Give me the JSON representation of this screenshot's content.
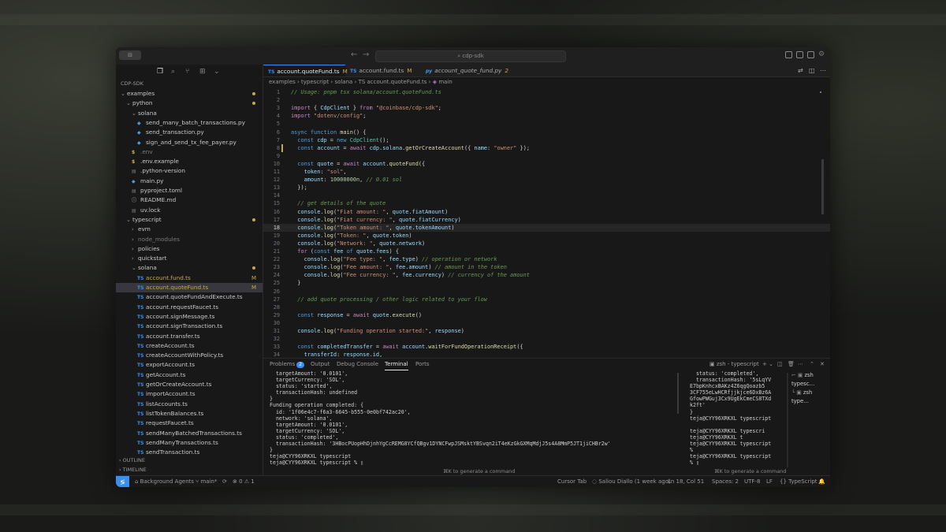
{
  "window": {
    "title": "cdp-sdk",
    "sidebar_toggle": "⊟"
  },
  "explorer": {
    "root": "CDP-SDK",
    "rows": [
      {
        "label": "examples",
        "kind": "folder",
        "open": true,
        "depth": 0,
        "mod": "dot"
      },
      {
        "label": "python",
        "kind": "folder",
        "open": true,
        "depth": 1,
        "mod": "dot"
      },
      {
        "label": "solana",
        "kind": "folder",
        "open": true,
        "depth": 2,
        "mod": ""
      },
      {
        "label": "send_many_batch_transactions.py",
        "kind": "py",
        "depth": 3,
        "mod": ""
      },
      {
        "label": "send_transaction.py",
        "kind": "py",
        "depth": 3,
        "mod": ""
      },
      {
        "label": "sign_and_send_tx_fee_payer.py",
        "kind": "py",
        "depth": 3,
        "mod": ""
      },
      {
        "label": ".env",
        "kind": "env",
        "depth": 2,
        "mod": "",
        "dim": true
      },
      {
        "label": ".env.example",
        "kind": "env",
        "depth": 2,
        "mod": ""
      },
      {
        "label": ".python-version",
        "kind": "file",
        "depth": 2,
        "mod": ""
      },
      {
        "label": "main.py",
        "kind": "py",
        "depth": 2,
        "mod": ""
      },
      {
        "label": "pyproject.toml",
        "kind": "file",
        "depth": 2,
        "mod": ""
      },
      {
        "label": "README.md",
        "kind": "info",
        "depth": 2,
        "mod": ""
      },
      {
        "label": "uv.lock",
        "kind": "file",
        "depth": 2,
        "mod": ""
      },
      {
        "label": "typescript",
        "kind": "folder",
        "open": true,
        "depth": 1,
        "mod": "dot"
      },
      {
        "label": "evm",
        "kind": "folder",
        "open": false,
        "depth": 2,
        "mod": ""
      },
      {
        "label": "node_modules",
        "kind": "folder",
        "open": false,
        "depth": 2,
        "mod": "",
        "dim": true
      },
      {
        "label": "policies",
        "kind": "folder",
        "open": false,
        "depth": 2,
        "mod": ""
      },
      {
        "label": "quickstart",
        "kind": "folder",
        "open": false,
        "depth": 2,
        "mod": ""
      },
      {
        "label": "solana",
        "kind": "folder",
        "open": true,
        "depth": 2,
        "mod": "dot"
      },
      {
        "label": "account.fund.ts",
        "kind": "ts",
        "depth": 3,
        "mod": "M"
      },
      {
        "label": "account.quoteFund.ts",
        "kind": "ts",
        "depth": 3,
        "mod": "M",
        "selected": true
      },
      {
        "label": "account.quoteFundAndExecute.ts",
        "kind": "ts",
        "depth": 3,
        "mod": ""
      },
      {
        "label": "account.requestFaucet.ts",
        "kind": "ts",
        "depth": 3,
        "mod": ""
      },
      {
        "label": "account.signMessage.ts",
        "kind": "ts",
        "depth": 3,
        "mod": ""
      },
      {
        "label": "account.signTransaction.ts",
        "kind": "ts",
        "depth": 3,
        "mod": ""
      },
      {
        "label": "account.transfer.ts",
        "kind": "ts",
        "depth": 3,
        "mod": ""
      },
      {
        "label": "createAccount.ts",
        "kind": "ts",
        "depth": 3,
        "mod": ""
      },
      {
        "label": "createAccountWithPolicy.ts",
        "kind": "ts",
        "depth": 3,
        "mod": ""
      },
      {
        "label": "exportAccount.ts",
        "kind": "ts",
        "depth": 3,
        "mod": ""
      },
      {
        "label": "getAccount.ts",
        "kind": "ts",
        "depth": 3,
        "mod": ""
      },
      {
        "label": "getOrCreateAccount.ts",
        "kind": "ts",
        "depth": 3,
        "mod": ""
      },
      {
        "label": "importAccount.ts",
        "kind": "ts",
        "depth": 3,
        "mod": ""
      },
      {
        "label": "listAccounts.ts",
        "kind": "ts",
        "depth": 3,
        "mod": ""
      },
      {
        "label": "listTokenBalances.ts",
        "kind": "ts",
        "depth": 3,
        "mod": ""
      },
      {
        "label": "requestFaucet.ts",
        "kind": "ts",
        "depth": 3,
        "mod": ""
      },
      {
        "label": "sendManyBatchedTransactions.ts",
        "kind": "ts",
        "depth": 3,
        "mod": ""
      },
      {
        "label": "sendManyTransactions.ts",
        "kind": "ts",
        "depth": 3,
        "mod": ""
      },
      {
        "label": "sendTransaction.ts",
        "kind": "ts",
        "depth": 3,
        "mod": ""
      }
    ],
    "outline": "OUTLINE",
    "timeline": "TIMELINE"
  },
  "tabs": [
    {
      "label": "account.quoteFund.ts",
      "icon": "TS",
      "mod": "M",
      "active": true
    },
    {
      "label": "account.fund.ts",
      "icon": "TS",
      "mod": "M",
      "active": false
    },
    {
      "label": "account_quote_fund.py",
      "icon": "py",
      "mod": "2",
      "active": false
    }
  ],
  "breadcrumbs": [
    "examples",
    "typescript",
    "solana",
    "TS account.quoteFund.ts",
    "main"
  ],
  "code": {
    "current_line": 18,
    "modified_lines": [
      8
    ],
    "lines": [
      [
        [
          "c",
          "// Usage: pnpm tsx solana/account.quoteFund.ts"
        ]
      ],
      [],
      [
        [
          "k",
          "import"
        ],
        [
          "p",
          " { "
        ],
        [
          "v",
          "CdpClient"
        ],
        [
          "p",
          " } "
        ],
        [
          "k",
          "from"
        ],
        [
          "s",
          " \"@coinbase/cdp-sdk\""
        ],
        [
          "p",
          ";"
        ]
      ],
      [
        [
          "k",
          "import"
        ],
        [
          "s",
          " \"dotenv/config\""
        ],
        [
          "p",
          ";"
        ]
      ],
      [],
      [
        [
          "kw",
          "async"
        ],
        [
          "kw",
          " function"
        ],
        [
          "f",
          " main"
        ],
        [
          "p",
          "() {"
        ]
      ],
      [
        [
          "kw",
          "  const"
        ],
        [
          "v",
          " cdp"
        ],
        [
          "p",
          " = "
        ],
        [
          "kw",
          "new"
        ],
        [
          "t",
          " CdpClient"
        ],
        [
          "p",
          "();"
        ]
      ],
      [
        [
          "kw",
          "  const"
        ],
        [
          "v",
          " account"
        ],
        [
          "p",
          " = "
        ],
        [
          "k",
          "await"
        ],
        [
          "v",
          " cdp"
        ],
        [
          "p",
          "."
        ],
        [
          "v",
          "solana"
        ],
        [
          "p",
          "."
        ],
        [
          "f",
          "getOrCreateAccount"
        ],
        [
          "p",
          "({ "
        ],
        [
          "v",
          "name"
        ],
        [
          "p",
          ": "
        ],
        [
          "s",
          "\"owner\""
        ],
        [
          "p",
          " });"
        ]
      ],
      [],
      [
        [
          "kw",
          "  const"
        ],
        [
          "v",
          " quote"
        ],
        [
          "p",
          " = "
        ],
        [
          "k",
          "await"
        ],
        [
          "v",
          " account"
        ],
        [
          "p",
          "."
        ],
        [
          "f",
          "quoteFund"
        ],
        [
          "p",
          "({"
        ]
      ],
      [
        [
          "v",
          "    token"
        ],
        [
          "p",
          ": "
        ],
        [
          "s",
          "\"sol\""
        ],
        [
          "p",
          ","
        ]
      ],
      [
        [
          "v",
          "    amount"
        ],
        [
          "p",
          ": "
        ],
        [
          "n",
          "10000000n"
        ],
        [
          "p",
          ", "
        ],
        [
          "c",
          "// 0.01 sol"
        ]
      ],
      [
        [
          "p",
          "  });"
        ]
      ],
      [],
      [
        [
          "c",
          "  // get details of the quote"
        ]
      ],
      [
        [
          "v",
          "  console"
        ],
        [
          "p",
          "."
        ],
        [
          "f",
          "log"
        ],
        [
          "p",
          "("
        ],
        [
          "s",
          "\"Fiat amount: \""
        ],
        [
          "p",
          ", "
        ],
        [
          "v",
          "quote"
        ],
        [
          "p",
          "."
        ],
        [
          "v",
          "fiatAmount"
        ],
        [
          "p",
          ")"
        ]
      ],
      [
        [
          "v",
          "  console"
        ],
        [
          "p",
          "."
        ],
        [
          "f",
          "log"
        ],
        [
          "p",
          "("
        ],
        [
          "s",
          "\"Fiat currency: \""
        ],
        [
          "p",
          ", "
        ],
        [
          "v",
          "quote"
        ],
        [
          "p",
          "."
        ],
        [
          "v",
          "fiatCurrency"
        ],
        [
          "p",
          ")"
        ]
      ],
      [
        [
          "v",
          "  console"
        ],
        [
          "p",
          "."
        ],
        [
          "f",
          "log"
        ],
        [
          "p",
          "("
        ],
        [
          "s",
          "\"Token amount: \""
        ],
        [
          "p",
          ", "
        ],
        [
          "v",
          "quote"
        ],
        [
          "p",
          "."
        ],
        [
          "v",
          "tokenAmount"
        ],
        [
          "p",
          ")"
        ]
      ],
      [
        [
          "v",
          "  console"
        ],
        [
          "p",
          "."
        ],
        [
          "f",
          "log"
        ],
        [
          "p",
          "("
        ],
        [
          "s",
          "\"Token: \""
        ],
        [
          "p",
          ", "
        ],
        [
          "v",
          "quote"
        ],
        [
          "p",
          "."
        ],
        [
          "v",
          "token"
        ],
        [
          "p",
          ")"
        ]
      ],
      [
        [
          "v",
          "  console"
        ],
        [
          "p",
          "."
        ],
        [
          "f",
          "log"
        ],
        [
          "p",
          "("
        ],
        [
          "s",
          "\"Network: \""
        ],
        [
          "p",
          ", "
        ],
        [
          "v",
          "quote"
        ],
        [
          "p",
          "."
        ],
        [
          "v",
          "network"
        ],
        [
          "p",
          ")"
        ]
      ],
      [
        [
          "k",
          "  for"
        ],
        [
          "p",
          " ("
        ],
        [
          "kw",
          "const"
        ],
        [
          "v",
          " fee"
        ],
        [
          "kw",
          " of"
        ],
        [
          "v",
          " quote"
        ],
        [
          "p",
          "."
        ],
        [
          "v",
          "fees"
        ],
        [
          "p",
          ") {"
        ]
      ],
      [
        [
          "v",
          "    console"
        ],
        [
          "p",
          "."
        ],
        [
          "f",
          "log"
        ],
        [
          "p",
          "("
        ],
        [
          "s",
          "\"Fee type: \""
        ],
        [
          "p",
          ", "
        ],
        [
          "v",
          "fee"
        ],
        [
          "p",
          "."
        ],
        [
          "v",
          "type"
        ],
        [
          "p",
          ") "
        ],
        [
          "c",
          "// operation or network"
        ]
      ],
      [
        [
          "v",
          "    console"
        ],
        [
          "p",
          "."
        ],
        [
          "f",
          "log"
        ],
        [
          "p",
          "("
        ],
        [
          "s",
          "\"Fee amount: \""
        ],
        [
          "p",
          ", "
        ],
        [
          "v",
          "fee"
        ],
        [
          "p",
          "."
        ],
        [
          "v",
          "amount"
        ],
        [
          "p",
          ") "
        ],
        [
          "c",
          "// amount in the token"
        ]
      ],
      [
        [
          "v",
          "    console"
        ],
        [
          "p",
          "."
        ],
        [
          "f",
          "log"
        ],
        [
          "p",
          "("
        ],
        [
          "s",
          "\"Fee currency: \""
        ],
        [
          "p",
          ", "
        ],
        [
          "v",
          "fee"
        ],
        [
          "p",
          "."
        ],
        [
          "v",
          "currency"
        ],
        [
          "p",
          ") "
        ],
        [
          "c",
          "// currency of the amount"
        ]
      ],
      [
        [
          "p",
          "  }"
        ]
      ],
      [],
      [
        [
          "c",
          "  // add quote processing / other logic related to your flow"
        ]
      ],
      [],
      [
        [
          "kw",
          "  const"
        ],
        [
          "v",
          " response"
        ],
        [
          "p",
          " = "
        ],
        [
          "k",
          "await"
        ],
        [
          "v",
          " quote"
        ],
        [
          "p",
          "."
        ],
        [
          "f",
          "execute"
        ],
        [
          "p",
          "()"
        ]
      ],
      [],
      [
        [
          "v",
          "  console"
        ],
        [
          "p",
          "."
        ],
        [
          "f",
          "log"
        ],
        [
          "p",
          "("
        ],
        [
          "s",
          "\"Funding operation started:\""
        ],
        [
          "p",
          ", "
        ],
        [
          "v",
          "response"
        ],
        [
          "p",
          ")"
        ]
      ],
      [],
      [
        [
          "kw",
          "  const"
        ],
        [
          "v",
          " completedTransfer"
        ],
        [
          "p",
          " = "
        ],
        [
          "k",
          "await"
        ],
        [
          "v",
          " account"
        ],
        [
          "p",
          "."
        ],
        [
          "f",
          "waitForFundOperationReceipt"
        ],
        [
          "p",
          "({"
        ]
      ],
      [
        [
          "v",
          "    transferId"
        ],
        [
          "p",
          ": "
        ],
        [
          "v",
          "response"
        ],
        [
          "p",
          "."
        ],
        [
          "v",
          "id"
        ],
        [
          "p",
          ","
        ]
      ]
    ]
  },
  "panel": {
    "tabs": [
      {
        "label": "Problems",
        "badge": "2"
      },
      {
        "label": "Output"
      },
      {
        "label": "Debug Console"
      },
      {
        "label": "Terminal",
        "active": true
      },
      {
        "label": "Ports"
      }
    ],
    "terminal_title": "zsh - typescript",
    "terminal_list": [
      "zsh  typesc…",
      "zsh  type…"
    ],
    "term_left": [
      "  targetAmount: '0.0101',",
      "  targetCurrency: 'SOL',",
      "  status: 'started',",
      "  transactionHash: undefined",
      "}",
      "Funding operation completed: {",
      "  id: '1f06e4c7-f6a3-6645-b555-0e0bf742ac20',",
      "  network: 'solana',",
      "  targetAmount: '0.0101',",
      "  targetCurrency: 'SOL',",
      "  status: 'completed',",
      "  transactionHash: '3HBocPUopHhDjnhYgCcREMG8YCfQBgv1DYNCFwpJSMsktYBSvqn2iT4eKzGkGXMqMdjJ5s4A8MmP5JT1jiCHBr2w'",
      "}",
      "teja@CYY96XRKXL typescript",
      "teja@CYY96XRKXL typescript % ▯"
    ],
    "term_right": [
      "  status: 'completed',",
      "  transactionHash: '5sLqYV",
      "E7bpKnhcxBAKz4Z6qgQoazb5",
      "3CF755eLwHCRfjjkjce6DxBz6A",
      "GfowPWGuj3Cx9UgEkCmeCS8TXd",
      "k2ft'",
      "}",
      "teja@CYY96XRKXL typescript",
      "",
      "teja@CYY96XRKXL typescri",
      "teja@CYY96XRKXL t",
      "teja@CYY96XRKXL typescript",
      "%",
      "teja@CYY96XRKXL typescript",
      "% ▯"
    ],
    "generate_hint": "⌘K to generate a command"
  },
  "statusbar": {
    "remote": "≶",
    "agents": "Background Agents",
    "branch": "main*",
    "sync": "⟳",
    "problems": "⊗ 0  ⚠ 1",
    "cursor_tab": "Cursor Tab",
    "blame": "Saliou Diallo (1 week ago)",
    "position": "Ln 18, Col 51",
    "spaces": "Spaces: 2",
    "encoding": "UTF-8",
    "eol": "LF",
    "language": "{} TypeScript",
    "bell": "🔔"
  }
}
